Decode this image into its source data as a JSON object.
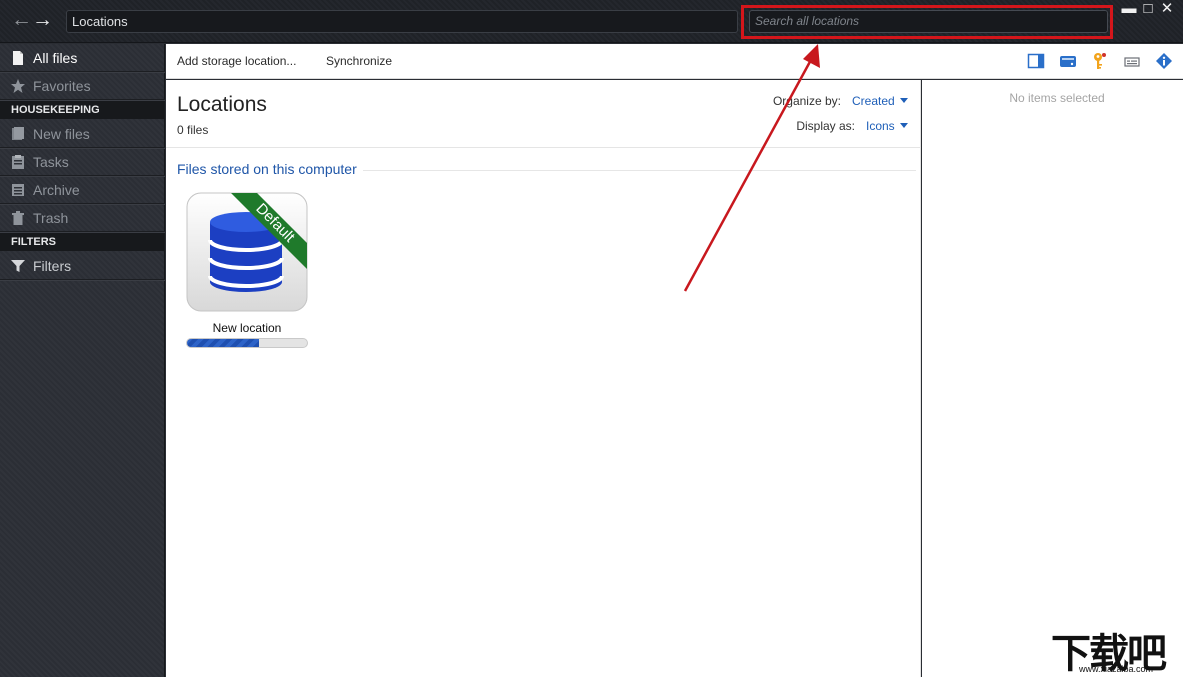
{
  "titlebar": {
    "location": "Locations",
    "search_placeholder": "Search all locations",
    "minimize": "▬",
    "maximize": "□",
    "close": "✕"
  },
  "sidebar": {
    "items": [
      {
        "label": "All files",
        "icon": "document-icon",
        "active": true
      },
      {
        "label": "Favorites",
        "icon": "star-icon",
        "active": false
      }
    ],
    "housekeeping_header": "HOUSEKEEPING",
    "housekeeping": [
      {
        "label": "New files",
        "icon": "new-files-icon"
      },
      {
        "label": "Tasks",
        "icon": "clipboard-icon"
      },
      {
        "label": "Archive",
        "icon": "archive-icon"
      },
      {
        "label": "Trash",
        "icon": "trash-icon"
      }
    ],
    "filters_header": "FILTERS",
    "filters": [
      {
        "label": "Filters",
        "icon": "funnel-icon"
      }
    ]
  },
  "toolbar": {
    "add_label": "Add storage location...",
    "sync_label": "Synchronize",
    "icons": [
      "panel-icon",
      "drive-icon",
      "key-icon",
      "tag-icon",
      "info-icon"
    ]
  },
  "main": {
    "title": "Locations",
    "file_count": "0 files",
    "organize_label": "Organize by:",
    "organize_value": "Created",
    "display_label": "Display as:",
    "display_value": "Icons",
    "section_title": "Files stored on this computer",
    "tiles": [
      {
        "label": "New location",
        "ribbon": "Default",
        "progress": 0.6
      }
    ]
  },
  "details": {
    "empty_text": "No items selected"
  },
  "colors": {
    "accent": "#1f5fb8",
    "highlight": "#d4161b",
    "ribbon": "#1f7a2b",
    "database": "#1c3fc2"
  },
  "watermark": {
    "text": "下载吧",
    "url": "www.xiazaiba.com"
  }
}
